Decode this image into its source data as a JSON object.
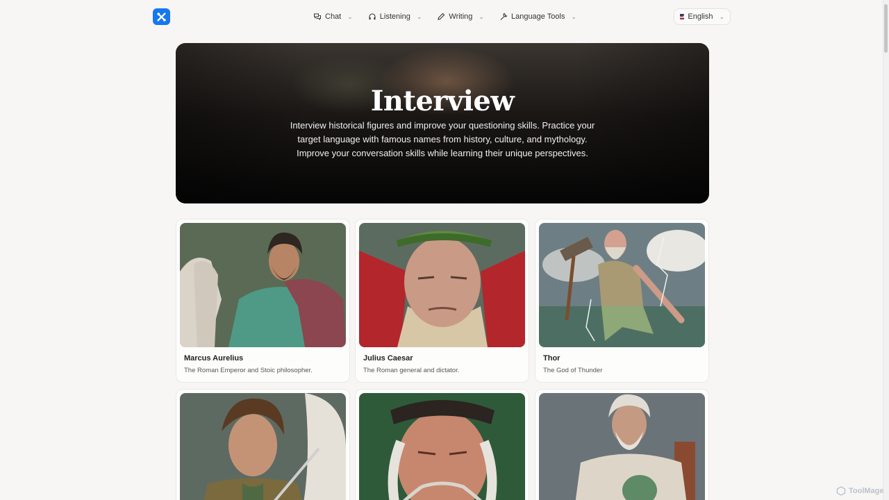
{
  "nav": {
    "items": [
      {
        "label": "Chat",
        "icon": "chat-icon"
      },
      {
        "label": "Listening",
        "icon": "headphones-icon"
      },
      {
        "label": "Writing",
        "icon": "pencil-icon"
      },
      {
        "label": "Language Tools",
        "icon": "wrench-icon"
      }
    ],
    "language": "English"
  },
  "hero": {
    "title": "Interview",
    "description": "Interview historical figures and improve your questioning skills. Practice your target language with famous names from history, culture, and mythology. Improve your conversation skills while learning their unique perspectives."
  },
  "figures": [
    {
      "name": "Marcus Aurelius",
      "description": "The Roman Emperor and Stoic philosopher."
    },
    {
      "name": "Julius Caesar",
      "description": "The Roman general and dictator."
    },
    {
      "name": "Thor",
      "description": "The God of Thunder"
    },
    {
      "name": "",
      "description": ""
    },
    {
      "name": "",
      "description": ""
    },
    {
      "name": "",
      "description": ""
    }
  ],
  "watermark": "ToolMage",
  "colors": {
    "accent": "#1677ee",
    "background": "#f7f6f4"
  }
}
